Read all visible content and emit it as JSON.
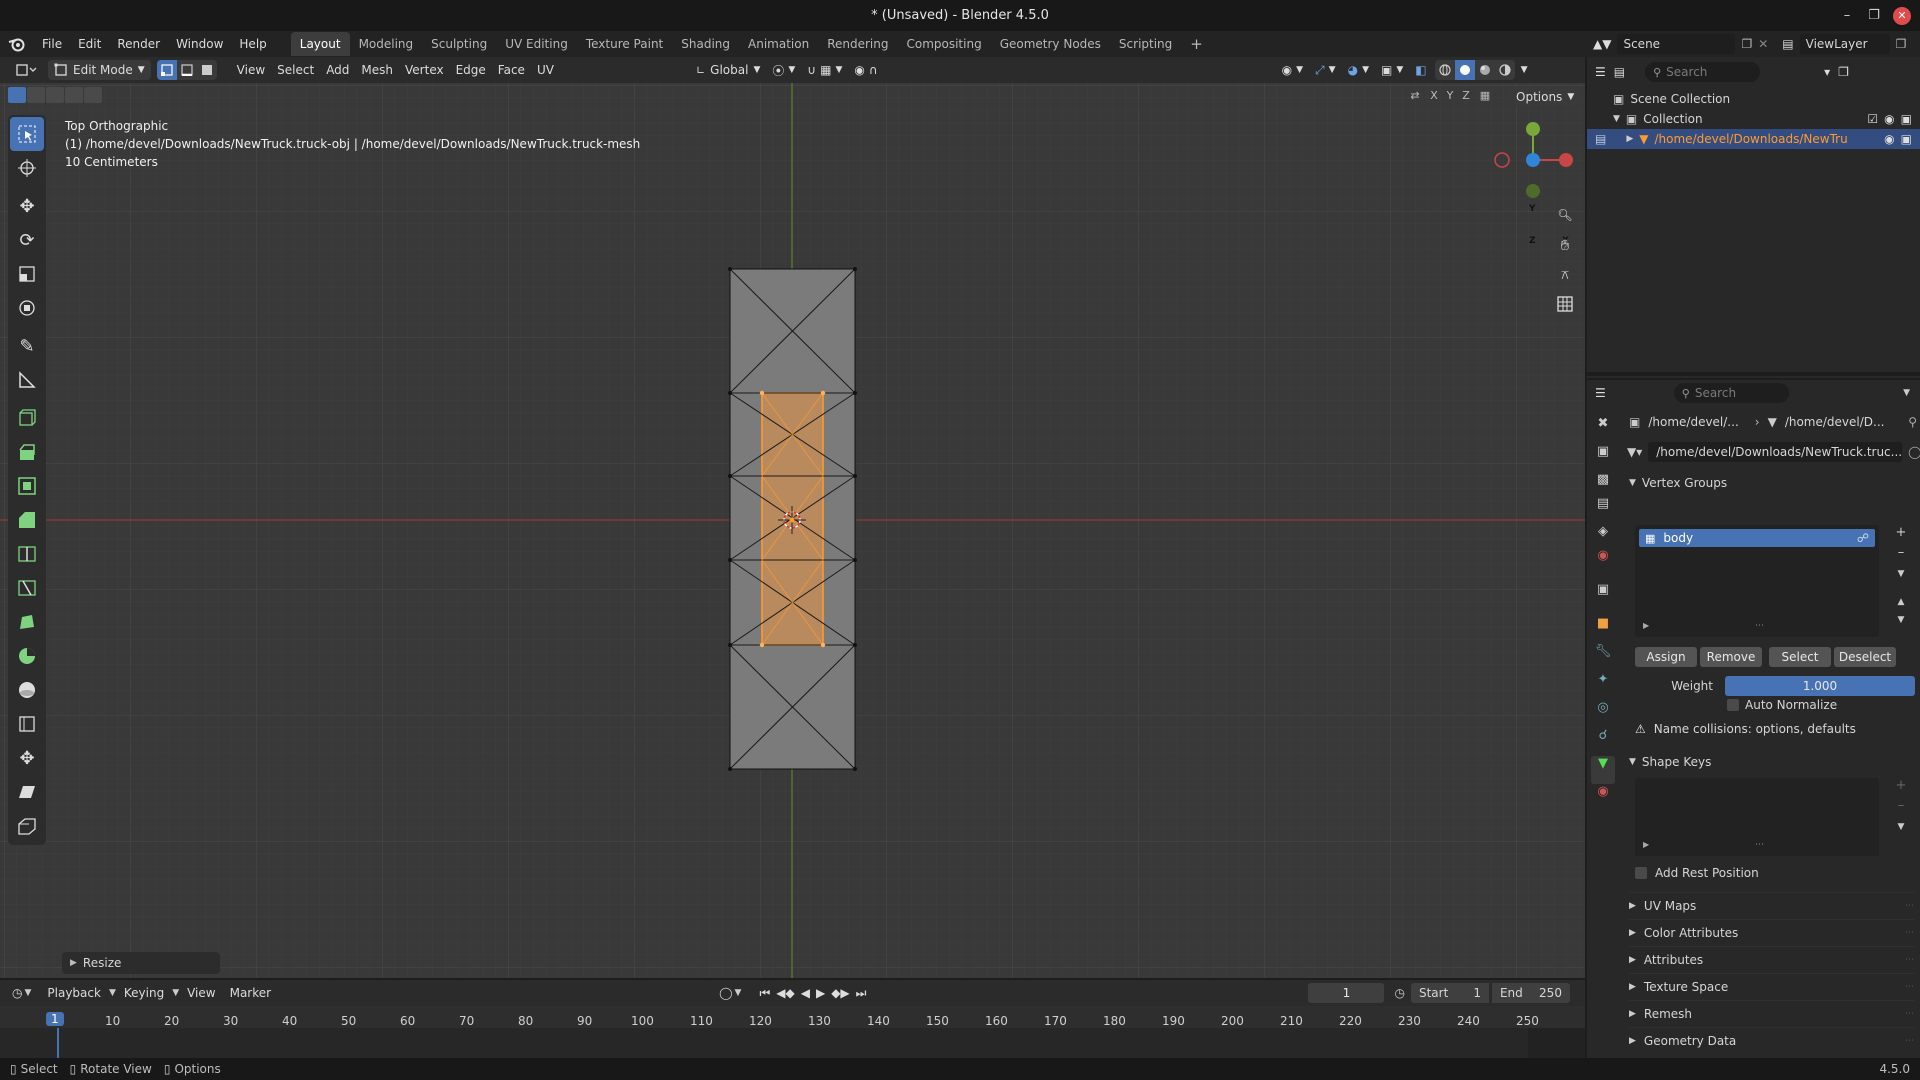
{
  "window": {
    "title": "* (Unsaved) - Blender 4.5.0"
  },
  "menu": [
    "File",
    "Edit",
    "Render",
    "Window",
    "Help"
  ],
  "workspaces": [
    "Layout",
    "Modeling",
    "Sculpting",
    "UV Editing",
    "Texture Paint",
    "Shading",
    "Animation",
    "Rendering",
    "Compositing",
    "Geometry Nodes",
    "Scripting"
  ],
  "active_workspace": "Layout",
  "viewport_header": {
    "mode": "Edit Mode",
    "menus": [
      "View",
      "Select",
      "Add",
      "Mesh",
      "Vertex",
      "Edge",
      "Face",
      "UV"
    ],
    "transform_orientation": "Global",
    "options_label": "Options",
    "axes": [
      "X",
      "Y",
      "Z"
    ]
  },
  "viewport": {
    "view_name": "Top Orthographic",
    "object_path": "(1) /home/devel/Downloads/NewTruck.truck-obj | /home/devel/Downloads/NewTruck.truck-mesh",
    "scale": "10 Centimeters",
    "last_operator": "Resize",
    "gizmo_labels": [
      "X",
      "Y",
      "Z"
    ],
    "colors": {
      "selection": "#ff9a2e",
      "x_axis": "#c84646",
      "y_axis": "#7aa73a",
      "z_axis": "#2f86d9"
    }
  },
  "outliner": {
    "scene_label": "Scene",
    "viewlayer_label": "ViewLayer",
    "search_placeholder": "Search",
    "items": [
      {
        "label": "Scene Collection"
      },
      {
        "label": "Collection"
      },
      {
        "label": "/home/devel/Downloads/NewTru"
      }
    ]
  },
  "properties": {
    "search_placeholder": "Search",
    "breadcrumb": [
      "/home/devel/...",
      "/home/devel/D..."
    ],
    "mesh_name": "/home/devel/Downloads/NewTruck.truc...",
    "vertex_groups": {
      "title": "Vertex Groups",
      "items": [
        "body"
      ],
      "buttons": [
        "Assign",
        "Remove",
        "Select",
        "Deselect"
      ],
      "weight_label": "Weight",
      "weight_value": "1.000",
      "auto_normalize": "Auto Normalize",
      "warning": "Name collisions: options, defaults"
    },
    "shape_keys": {
      "title": "Shape Keys",
      "add_rest_position": "Add Rest Position"
    },
    "collapsed_panels": [
      "UV Maps",
      "Color Attributes",
      "Attributes",
      "Texture Space",
      "Remesh",
      "Geometry Data"
    ]
  },
  "timeline": {
    "menus": [
      "Playback",
      "Keying",
      "View",
      "Marker"
    ],
    "current_frame": "1",
    "start_label": "Start",
    "start": "1",
    "end_label": "End",
    "end": "250",
    "ticks": [
      "1",
      "10",
      "20",
      "30",
      "40",
      "50",
      "60",
      "70",
      "80",
      "90",
      "100",
      "110",
      "120",
      "130",
      "140",
      "150",
      "160",
      "170",
      "180",
      "190",
      "200",
      "210",
      "220",
      "230",
      "240",
      "250"
    ]
  },
  "status": {
    "items": [
      "Select",
      "Rotate View",
      "Options"
    ],
    "version": "4.5.0"
  }
}
